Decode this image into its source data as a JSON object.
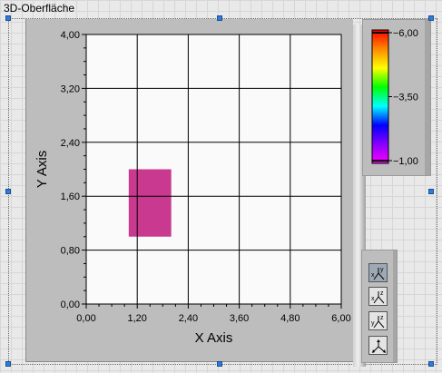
{
  "caption": "3D-Oberfläche",
  "chart_data": {
    "type": "heatmap",
    "xlabel": "X Axis",
    "ylabel": "Y Axis",
    "xlim": [
      0,
      6
    ],
    "ylim": [
      0,
      4
    ],
    "x_ticks": [
      "0,00",
      "1,20",
      "2,40",
      "3,60",
      "4,80",
      "6,00"
    ],
    "y_ticks": [
      "0,00",
      "0,80",
      "1,60",
      "2,40",
      "3,20",
      "4,00"
    ],
    "grid": true,
    "cells": [
      {
        "x0": 1.0,
        "x1": 2.0,
        "y0": 1.0,
        "y1": 2.0,
        "color": "#c8398f"
      }
    ]
  },
  "legend": {
    "ticks": [
      "6,00",
      "3,50",
      "1,00"
    ],
    "max": 6.0,
    "mid": 3.5,
    "min": 1.0,
    "gradient": [
      "#ff0000",
      "#ff8800",
      "#ffff00",
      "#00ff00",
      "#00ffff",
      "#0000ff",
      "#8800ff",
      "#ff00ff"
    ]
  },
  "tools": [
    {
      "name": "tool-xy-projection",
      "label_top": "y",
      "label_a": "x",
      "active": true
    },
    {
      "name": "tool-xz-projection",
      "label_top": "z",
      "label_a": "x",
      "active": false
    },
    {
      "name": "tool-yz-projection",
      "label_top": "z",
      "label_a": "y",
      "active": false
    },
    {
      "name": "tool-default-3d-view",
      "active": false
    }
  ],
  "colors": {
    "plot_bg": "#fafafa",
    "grid": "#000000",
    "panel": "#bdbdbd",
    "cell": "#c8398f"
  }
}
